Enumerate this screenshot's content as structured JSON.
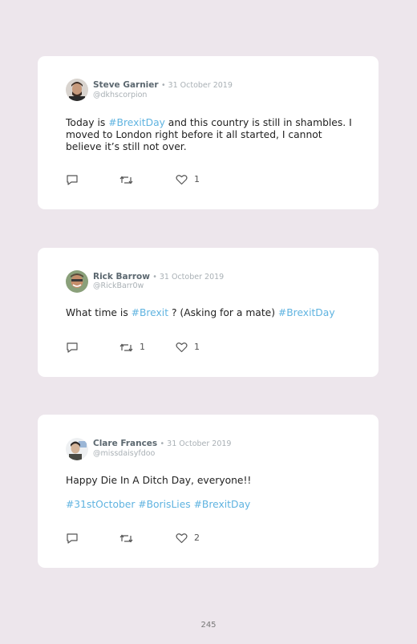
{
  "tweets": [
    {
      "name": "Steve Garnier",
      "date": "• 31 October 2019",
      "handle": "@dkhscorpion",
      "text_parts": [
        "Today is ",
        "#BrexitDay",
        " and this country is still in shambles. I moved to London right before it all started, I cannot believe it’s still not over."
      ],
      "retweets": "",
      "likes": "1",
      "avatar_colors": {
        "skin": "#c79a7c",
        "hair": "#3d2d24",
        "bg": "#d9d4cf"
      }
    },
    {
      "name": "Rick Barrow",
      "date": "• 31 October 2019",
      "handle": "@RickBarr0w",
      "text_parts": [
        "What time is ",
        "#Brexit",
        " ? (Asking for a mate) ",
        "#BrexitDay"
      ],
      "retweets": "1",
      "likes": "1",
      "avatar_colors": {
        "skin": "#c58d6a",
        "hair": "#5a4a3a",
        "bg": "#8aa07a"
      }
    },
    {
      "name": "Clare Frances",
      "date": "• 31 October 2019",
      "handle": "@missdaisyfdoo",
      "text": "Happy Die In A Ditch Day, everyone!!",
      "hashtags": "#31stOctober #BorisLies #BrexitDay",
      "retweets": "",
      "likes": "2",
      "avatar_colors": {
        "skin": "#d4b49a",
        "hair": "#2f2a28",
        "bg": "#6d7a8a"
      }
    }
  ],
  "page_number": "245",
  "colors": {
    "background": "#ede6ec",
    "card": "#ffffff",
    "hashtag": "#5fb3e0",
    "name": "#5c6870",
    "muted": "#a9b0b5"
  }
}
